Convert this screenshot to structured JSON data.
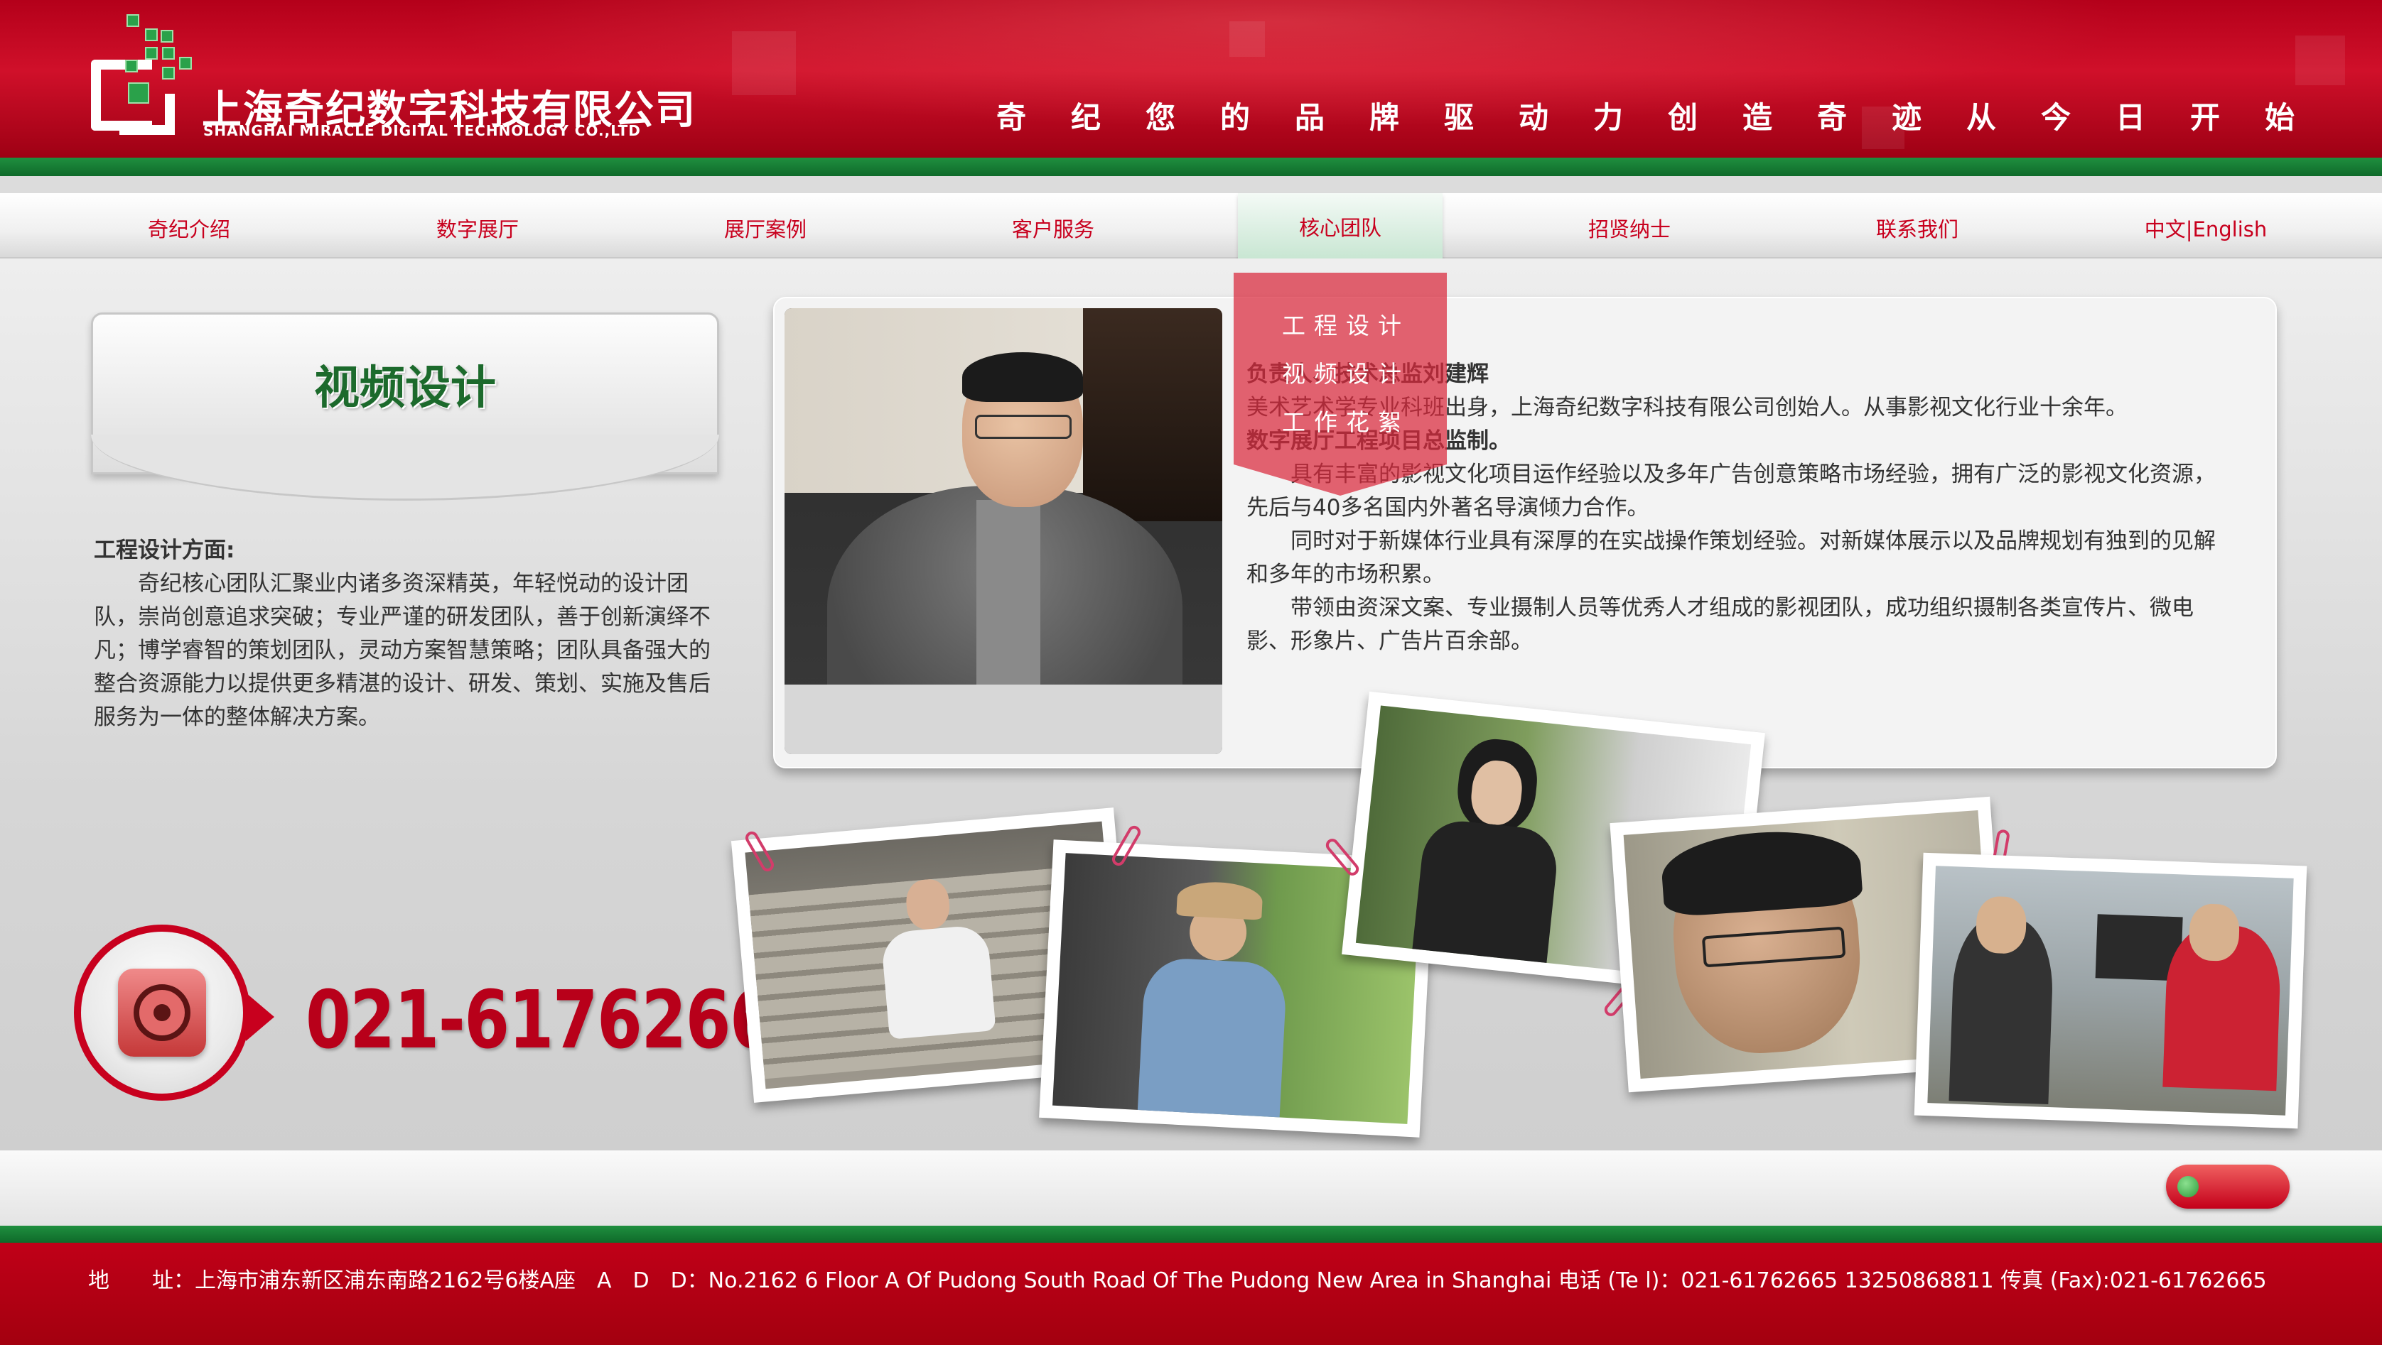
{
  "header": {
    "company_cn": "上海奇纪数字科技有限公司",
    "company_en": "SHANGHAI MIRACLE DIGITAL TECHNOLOGY CO.,LTD",
    "slogan": "奇纪您的品牌驱动力创造奇迹从今日开始",
    "logo_icon": "company-logo-icon"
  },
  "nav": {
    "items": [
      "奇纪介绍",
      "数字展厅",
      "展厅案例",
      "客户服务",
      "核心团队",
      "招贤纳士",
      "联系我们",
      "中文|English"
    ],
    "active": "核心团队",
    "dropdown": [
      "工程设计",
      "视频设计",
      "工作花絮"
    ]
  },
  "sidebar": {
    "title": "视频设计",
    "heading": "工程设计方面:",
    "body": "奇纪核心团队汇聚业内诸多资深精英，年轻悦动的设计团队，崇尚创意追求突破；专业严谨的研发团队，善于创新演绎不凡；博学睿智的策划团队，灵动方案智慧策略；团队具备强大的整合资源能力以提供更多精湛的设计、研发、策划、实施及售后服务为一体的整体解决方案。",
    "phone": "021-61762665",
    "phone_icon": "telephone-icon"
  },
  "profile": {
    "line1": "负责人、技术总监刘建辉",
    "line2": "美术艺术学专业科班出身，上海奇纪数字科技有限公司创始人。从事影视文化行业十余年。",
    "line3": "数字展厅工程项目总监制。",
    "para1": "具有丰富的影视文化项目运作经验以及多年广告创意策略市场经验，拥有广泛的影视文化资源，先后与40多名国内外著名导演倾力合作。",
    "para2": "同时对于新媒体行业具有深厚的在实战操作策划经验。对新媒体展示以及品牌规划有独到的见解和多年的市场积累。",
    "para3": "带领由资深文案、专业摄制人员等优秀人才组成的影视团队，成功组织摄制各类宣传片、微电影、形象片、广告片百余部。"
  },
  "footer": {
    "address": "地　　址：上海市浦东新区浦东南路2162号6楼A座　A　D　D：No.2162 6 Floor A Of Pudong South Road Of The Pudong New Area in Shanghai  电话 (Te l)：021-61762665 13250868811  传真 (Fax):021-61762665"
  },
  "colors": {
    "brand_red": "#c8001e",
    "brand_green": "#1c6a2c"
  }
}
